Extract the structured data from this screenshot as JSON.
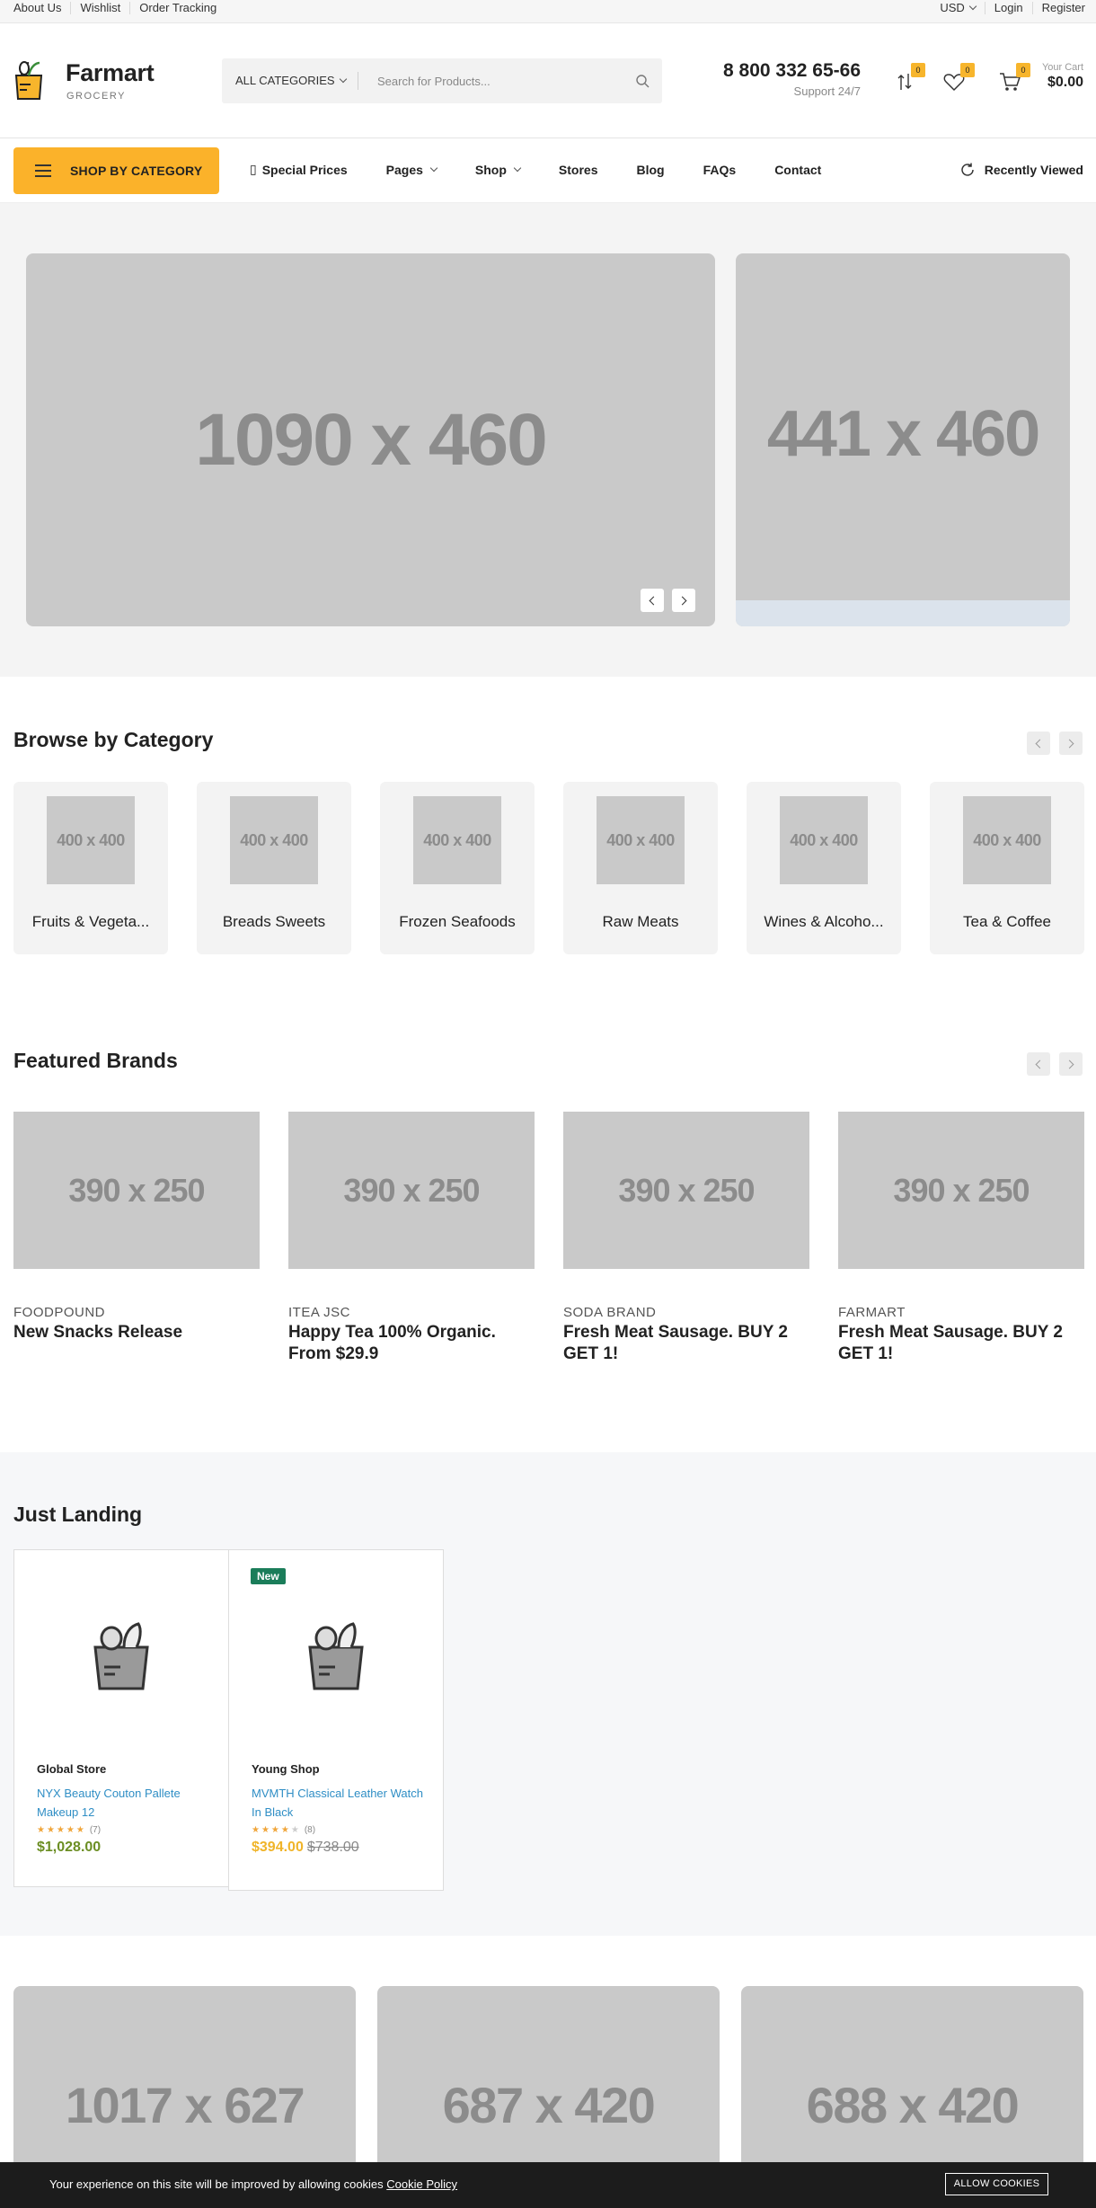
{
  "topbar": {
    "links": [
      "About Us",
      "Wishlist",
      "Order Tracking"
    ],
    "currency": "USD",
    "login": "Login",
    "register": "Register"
  },
  "header": {
    "logo_name": "Farmart",
    "logo_sub": "GROCERY",
    "search_category": "ALL CATEGORIES",
    "search_placeholder": "Search for Products...",
    "phone": "8 800 332 65-66",
    "support": "Support 24/7",
    "compare_count": "0",
    "wishlist_count": "0",
    "cart_count": "0",
    "cart_label": "Your Cart",
    "cart_total": "$0.00"
  },
  "nav": {
    "shop_by_category": "SHOP BY CATEGORY",
    "special_prices": "Special Prices",
    "pages": "Pages",
    "shop": "Shop",
    "stores": "Stores",
    "blog": "Blog",
    "faqs": "FAQs",
    "contact": "Contact",
    "recently_viewed": "Recently Viewed"
  },
  "hero": {
    "main_placeholder": "1090 x 460",
    "side_placeholder": "441 x 460"
  },
  "categories": {
    "title": "Browse by Category",
    "items": [
      {
        "placeholder": "400 x 400",
        "name": "Fruits & Vegeta..."
      },
      {
        "placeholder": "400 x 400",
        "name": "Breads Sweets"
      },
      {
        "placeholder": "400 x 400",
        "name": "Frozen Seafoods"
      },
      {
        "placeholder": "400 x 400",
        "name": "Raw Meats"
      },
      {
        "placeholder": "400 x 400",
        "name": "Wines & Alcoho..."
      },
      {
        "placeholder": "400 x 400",
        "name": "Tea & Coffee"
      }
    ]
  },
  "brands": {
    "title": "Featured Brands",
    "items": [
      {
        "placeholder": "390 x 250",
        "tag": "FOODPOUND",
        "title": "New Snacks Release"
      },
      {
        "placeholder": "390 x 250",
        "tag": "ITEA JSC",
        "title": "Happy Tea 100% Organic. From $29.9"
      },
      {
        "placeholder": "390 x 250",
        "tag": "SODA BRAND",
        "title": "Fresh Meat Sausage. BUY 2 GET 1!"
      },
      {
        "placeholder": "390 x 250",
        "tag": "FARMART",
        "title": "Fresh Meat Sausage. BUY 2 GET 1!"
      }
    ]
  },
  "landing": {
    "title": "Just Landing",
    "products": [
      {
        "badge": "",
        "store": "Global Store",
        "name": "NYX Beauty Couton Pallete Makeup 12",
        "rating": 5,
        "stars": "★★★★★",
        "reviews": "(7)",
        "price": "$1,028.00",
        "old_price": "",
        "price_color": "#6b8e23"
      },
      {
        "badge": "New",
        "store": "Young Shop",
        "name": "MVMTH Classical Leather Watch In Black",
        "rating": 4,
        "stars": "★★★★★",
        "reviews": "(8)",
        "price": "$394.00",
        "old_price": "$738.00",
        "price_color": "#f0b429"
      }
    ]
  },
  "banners": [
    {
      "placeholder": "1017 x 627"
    },
    {
      "placeholder": "687 x 420"
    },
    {
      "placeholder": "688 x 420"
    }
  ],
  "cookie": {
    "message": "Your experience on this site will be improved by allowing cookies",
    "policy_link": "Cookie Policy",
    "button": "ALLOW COOKIES"
  },
  "colors": {
    "accent": "#fbb22a",
    "link": "#2f8ec5",
    "badge_new": "#1b7d5a"
  }
}
